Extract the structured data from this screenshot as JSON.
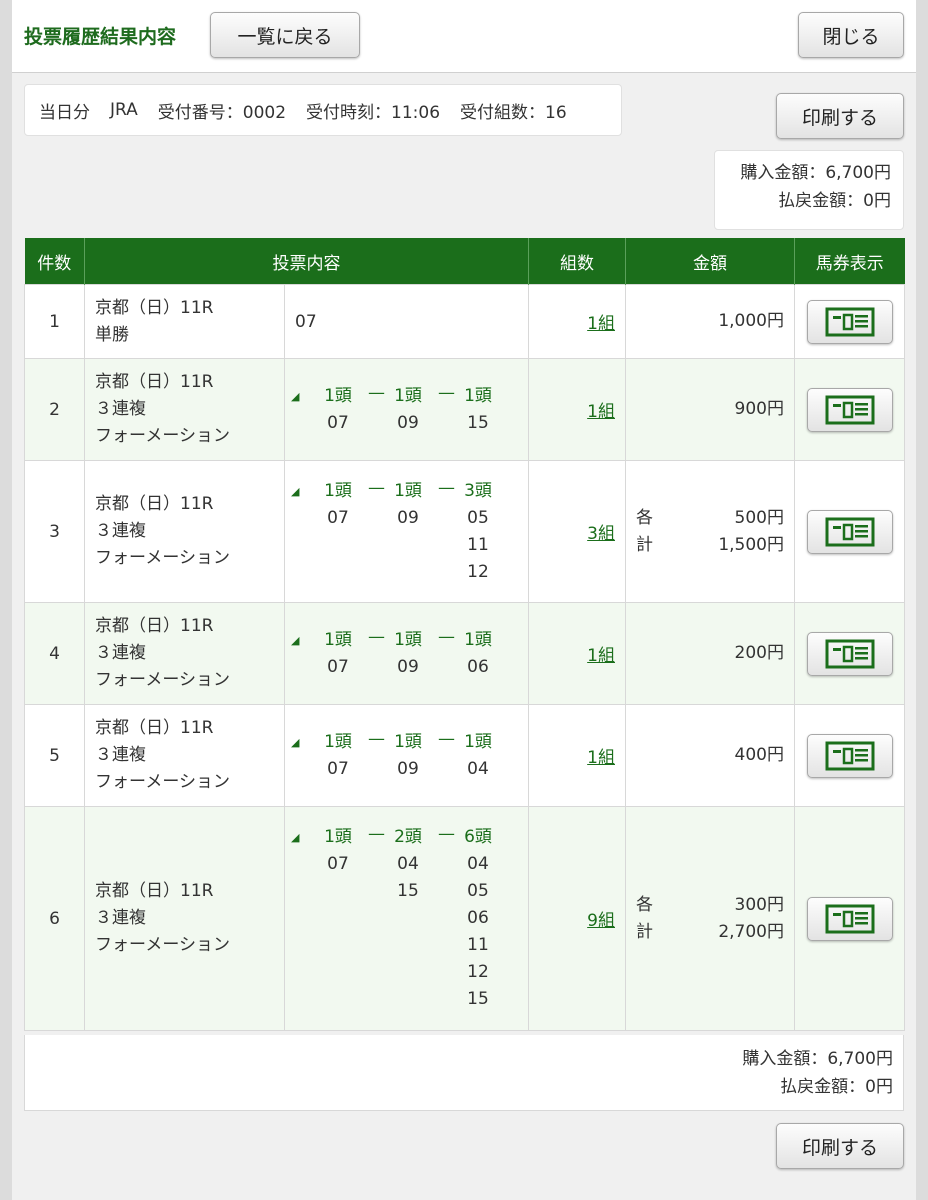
{
  "header": {
    "title": "投票履歴結果内容",
    "back_label": "一覧に戻る",
    "close_label": "閉じる"
  },
  "info": {
    "day": "当日分",
    "org": "JRA",
    "receipt_no": "受付番号：0002",
    "receipt_time": "受付時刻：11:06",
    "receipt_count": "受付組数：16"
  },
  "print_label": "印刷する",
  "totals": {
    "purchase": "購入金額：6,700円",
    "refund": "払戻金額：0円"
  },
  "table": {
    "headers": [
      "件数",
      "投票内容",
      "組数",
      "金額",
      "馬券表示"
    ],
    "rows": [
      {
        "no": "1",
        "race": [
          "京都（日）11R",
          "単勝"
        ],
        "single": "07",
        "kumi": "1組",
        "amounts": [
          {
            "label": "",
            "value": "1,000円"
          }
        ]
      },
      {
        "no": "2",
        "race": [
          "京都（日）11R",
          "３連複",
          "フォーメーション"
        ],
        "heads": [
          "1頭",
          "1頭",
          "1頭"
        ],
        "cols": [
          [
            "07"
          ],
          [
            "09"
          ],
          [
            "15"
          ]
        ],
        "kumi": "1組",
        "amounts": [
          {
            "label": "",
            "value": "900円"
          }
        ]
      },
      {
        "no": "3",
        "race": [
          "京都（日）11R",
          "３連複",
          "フォーメーション"
        ],
        "heads": [
          "1頭",
          "1頭",
          "3頭"
        ],
        "cols": [
          [
            "07"
          ],
          [
            "09"
          ],
          [
            "05",
            "11",
            "12"
          ]
        ],
        "kumi": "3組",
        "amounts": [
          {
            "label": "各",
            "value": "500円"
          },
          {
            "label": "計",
            "value": "1,500円"
          }
        ]
      },
      {
        "no": "4",
        "race": [
          "京都（日）11R",
          "３連複",
          "フォーメーション"
        ],
        "heads": [
          "1頭",
          "1頭",
          "1頭"
        ],
        "cols": [
          [
            "07"
          ],
          [
            "09"
          ],
          [
            "06"
          ]
        ],
        "kumi": "1組",
        "amounts": [
          {
            "label": "",
            "value": "200円"
          }
        ]
      },
      {
        "no": "5",
        "race": [
          "京都（日）11R",
          "３連複",
          "フォーメーション"
        ],
        "heads": [
          "1頭",
          "1頭",
          "1頭"
        ],
        "cols": [
          [
            "07"
          ],
          [
            "09"
          ],
          [
            "04"
          ]
        ],
        "kumi": "1組",
        "amounts": [
          {
            "label": "",
            "value": "400円"
          }
        ]
      },
      {
        "no": "6",
        "race": [
          "京都（日）11R",
          "３連複",
          "フォーメーション"
        ],
        "heads": [
          "1頭",
          "2頭",
          "6頭"
        ],
        "cols": [
          [
            "07"
          ],
          [
            "04",
            "15"
          ],
          [
            "04",
            "05",
            "06",
            "11",
            "12",
            "15"
          ]
        ],
        "kumi": "9組",
        "amounts": [
          {
            "label": "各",
            "value": "300円"
          },
          {
            "label": "計",
            "value": "2,700円"
          }
        ]
      }
    ]
  },
  "icons": {
    "ticket": "ticket-view-icon",
    "triangle": "triangle-marker-icon"
  },
  "colors": {
    "brand_green": "#1b6e1b",
    "alt_row": "#f2f9f0"
  }
}
